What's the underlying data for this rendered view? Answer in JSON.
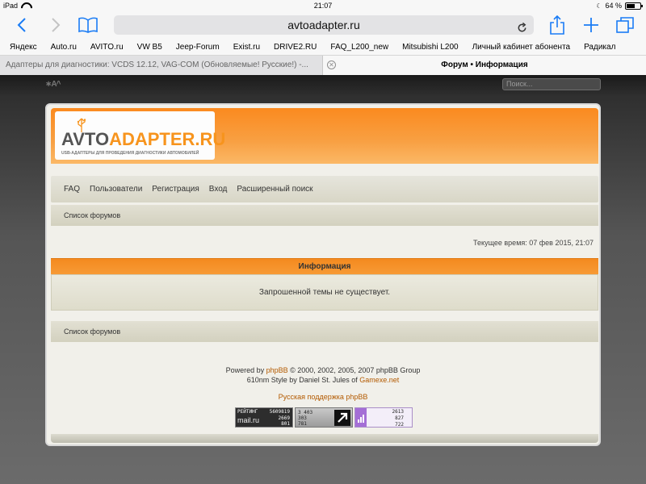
{
  "status": {
    "device": "iPad",
    "time": "21:07",
    "battery": "64 %",
    "battery_level": 0.64
  },
  "browser": {
    "url": "avtoadapter.ru",
    "favorites": [
      "Яндекс",
      "Auto.ru",
      "AVITO.ru",
      "VW B5",
      "Jeep-Forum",
      "Exist.ru",
      "DRIVE2.RU",
      "FAQ_L200_new",
      "Mitsubishi L200",
      "Личный кабинет абонента",
      "Радикал"
    ],
    "tabs": [
      {
        "label": "Адаптеры для диагностики: VCDS 12.12, VAG-COM (Обновляемые! Русские!) -..."
      },
      {
        "label": "Форум • Информация"
      }
    ]
  },
  "site": {
    "font_toggle": "∗A^",
    "search_placeholder": "Поиск...",
    "logo": {
      "part1": "AVTO",
      "part2": "ADAPTER.RU",
      "tagline": "USB-АДАПТЕРЫ ДЛЯ ПРОВЕДЕНИЯ ДИАГНОСТИКИ АВТОМОБИЛЕЙ"
    },
    "nav": [
      "FAQ",
      "Пользователи",
      "Регистрация",
      "Вход",
      "Расширенный поиск"
    ],
    "breadcrumb": "Список форумов",
    "current_time": "Текущее время: 07 фев 2015, 21:07",
    "info_title": "Информация",
    "info_message": "Запрошенной темы не существует.",
    "footer": {
      "line1_prefix": "Powered by ",
      "line1_link": "phpBB",
      "line1_suffix": " © 2000, 2002, 2005, 2007 phpBB Group",
      "line2_prefix": "610nm Style by Daniel St. Jules of ",
      "line2_link": "Gamexe.net",
      "support": "Русская поддержка phpBB"
    },
    "counters": {
      "mailru": {
        "label": "РЕЙТИНГ",
        "total": "5609819",
        "brand": "mail.ru",
        "v1": "2669",
        "v2": "801"
      },
      "li": {
        "v1": "3 403",
        "v2": "303",
        "v3": "781"
      },
      "third": {
        "v1": "2613",
        "v2": "827",
        "v3": "722"
      }
    }
  },
  "colors": {
    "accent_orange": "#f7941d",
    "safari_blue": "#1a7cf5"
  }
}
